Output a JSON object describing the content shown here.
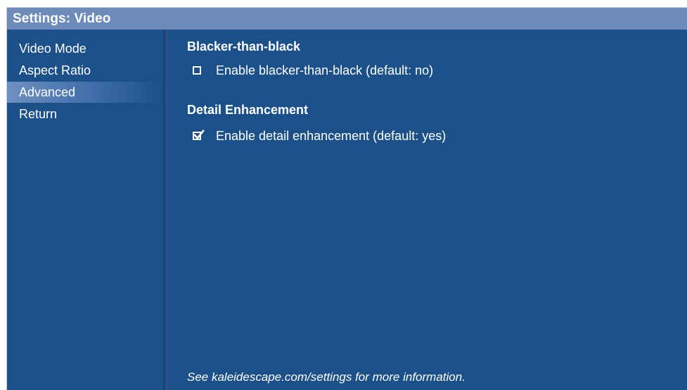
{
  "window": {
    "title": "Settings: Video"
  },
  "sidebar": {
    "items": [
      {
        "label": "Video Mode",
        "selected": false
      },
      {
        "label": "Aspect Ratio",
        "selected": false
      },
      {
        "label": "Advanced",
        "selected": true
      },
      {
        "label": "Return",
        "selected": false
      }
    ]
  },
  "sections": [
    {
      "heading": "Blacker-than-black",
      "option": {
        "label": "Enable blacker-than-black (default: no)",
        "checked": false,
        "icon": "checkbox-unchecked-icon"
      }
    },
    {
      "heading": "Detail Enhancement",
      "option": {
        "label": "Enable detail enhancement (default: yes)",
        "checked": true,
        "icon": "checkbox-checked-icon"
      }
    }
  ],
  "footer": {
    "note": "See kaleidescape.com/settings for more information."
  },
  "colors": {
    "background": "#1b5089",
    "titlebar": "#6c8bb9",
    "selection_highlight": "#6f91c2",
    "text": "#ffffff"
  }
}
